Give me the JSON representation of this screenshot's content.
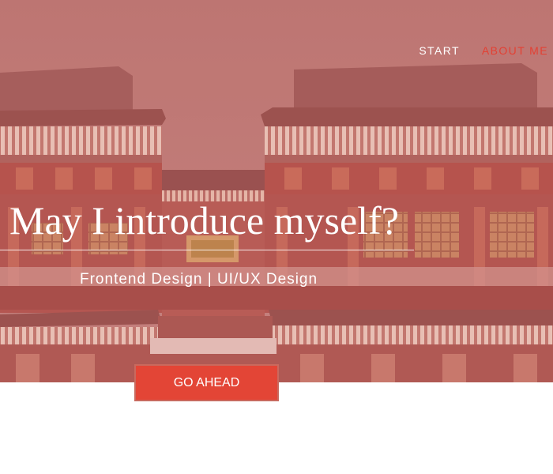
{
  "nav": {
    "items": [
      {
        "label": "START"
      },
      {
        "label": "ABOUT ME"
      }
    ],
    "active_color": "#e34033"
  },
  "hero": {
    "title": "May I introduce myself?",
    "subtitle": "Frontend Design | UI/UX Design",
    "cta_label": "GO AHEAD",
    "background": "red-pagoda-temple-photo",
    "overlay_color": "#c4837f"
  },
  "colors": {
    "accent": "#e34536",
    "text_on_hero": "#ffffff"
  }
}
